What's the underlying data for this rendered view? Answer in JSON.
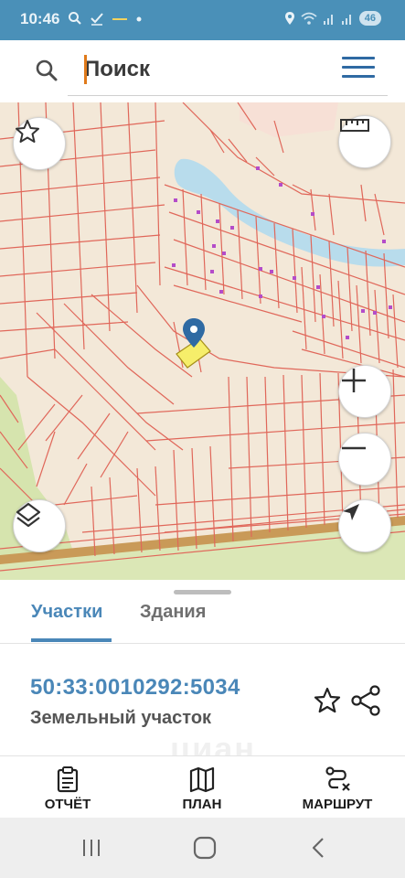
{
  "status_bar": {
    "time": "10:46",
    "battery": "46",
    "icons": [
      "search-icon",
      "check-icon",
      "line-icon",
      "dot-icon",
      "location-icon",
      "wifi-icon",
      "signal-icon",
      "signal-icon"
    ]
  },
  "search": {
    "placeholder": "Поиск",
    "value": ""
  },
  "header": {
    "menu_icon": "hamburger-menu-icon"
  },
  "map": {
    "buttons": [
      "star-icon",
      "ruler-icon",
      "zoom-in-icon",
      "zoom-out-icon",
      "layers-icon",
      "navigation-arrow-icon"
    ],
    "colors": {
      "background": "#f4eadb",
      "parcel_lines": "#e0675a",
      "water": "#b9dcec",
      "green": "#d8e6b0",
      "road": "#c89a5a",
      "selected_parcel": "#f6ee6a",
      "marker": "#2f6aa3",
      "building": "#b44cc9"
    }
  },
  "tabs": [
    {
      "label": "Участки",
      "active": true
    },
    {
      "label": "Здания",
      "active": false
    }
  ],
  "parcel": {
    "cadastral_number": "50:33:0010292:5034",
    "type": "Земельный участок"
  },
  "watermark": "циан",
  "bottom_nav": [
    {
      "label": "ОТЧЁТ",
      "icon": "report-clipboard-icon"
    },
    {
      "label": "ПЛАН",
      "icon": "map-plan-icon"
    },
    {
      "label": "МАРШРУТ",
      "icon": "route-icon"
    }
  ],
  "system_nav": [
    "recent-apps-icon",
    "home-icon",
    "back-icon"
  ],
  "accent_color": "#4a87b8"
}
